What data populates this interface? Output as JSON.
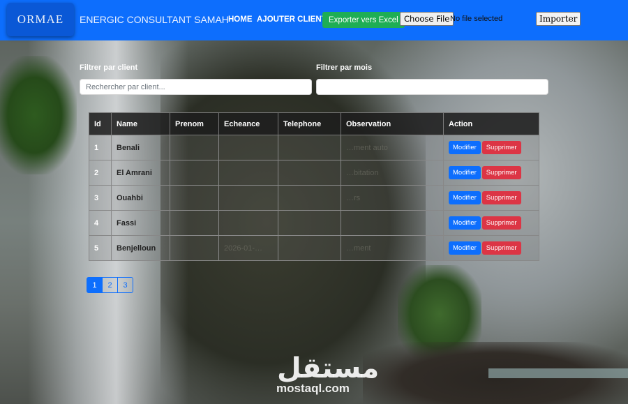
{
  "navbar": {
    "logo_text": "ORMAE",
    "brand": "ENERGIC CONSULTANT SAMAH",
    "links": [
      "HOME",
      "AJOUTER CLIENT"
    ],
    "export_button": "Exporter vers Excel",
    "file_button": "Choose File",
    "file_status": "No file selected",
    "import_button": "Importer",
    "color": "#0d6efd"
  },
  "filters": {
    "client_label": "Filtrer par client",
    "client_placeholder": "Rechercher par client...",
    "month_label": "Filtrer par mois",
    "month_value": ""
  },
  "table": {
    "headers": [
      "Id",
      "Name",
      "Prenom",
      "Echeance",
      "Telephone",
      "Observation",
      "Action"
    ],
    "rows": [
      {
        "id": "1",
        "name": "Benali",
        "observation": "…ment auto"
      },
      {
        "id": "2",
        "name": "El Amrani",
        "observation": "…bitation"
      },
      {
        "id": "3",
        "name": "Ouahbi",
        "observation": "…rs"
      },
      {
        "id": "4",
        "name": "Fassi",
        "observation": ""
      },
      {
        "id": "5",
        "name": "Benjelloun",
        "echeance": "2026-01-…",
        "observation": "…ment"
      }
    ],
    "edit_label": "Modifier",
    "delete_label": "Supprimer",
    "edit_color": "#0d6efd",
    "delete_color": "#dc3545"
  },
  "pagination": {
    "pages": [
      "1",
      "2",
      "3"
    ],
    "current": "1"
  },
  "watermark": {
    "arabic": "مستقل",
    "latin": "mostaql.com"
  }
}
